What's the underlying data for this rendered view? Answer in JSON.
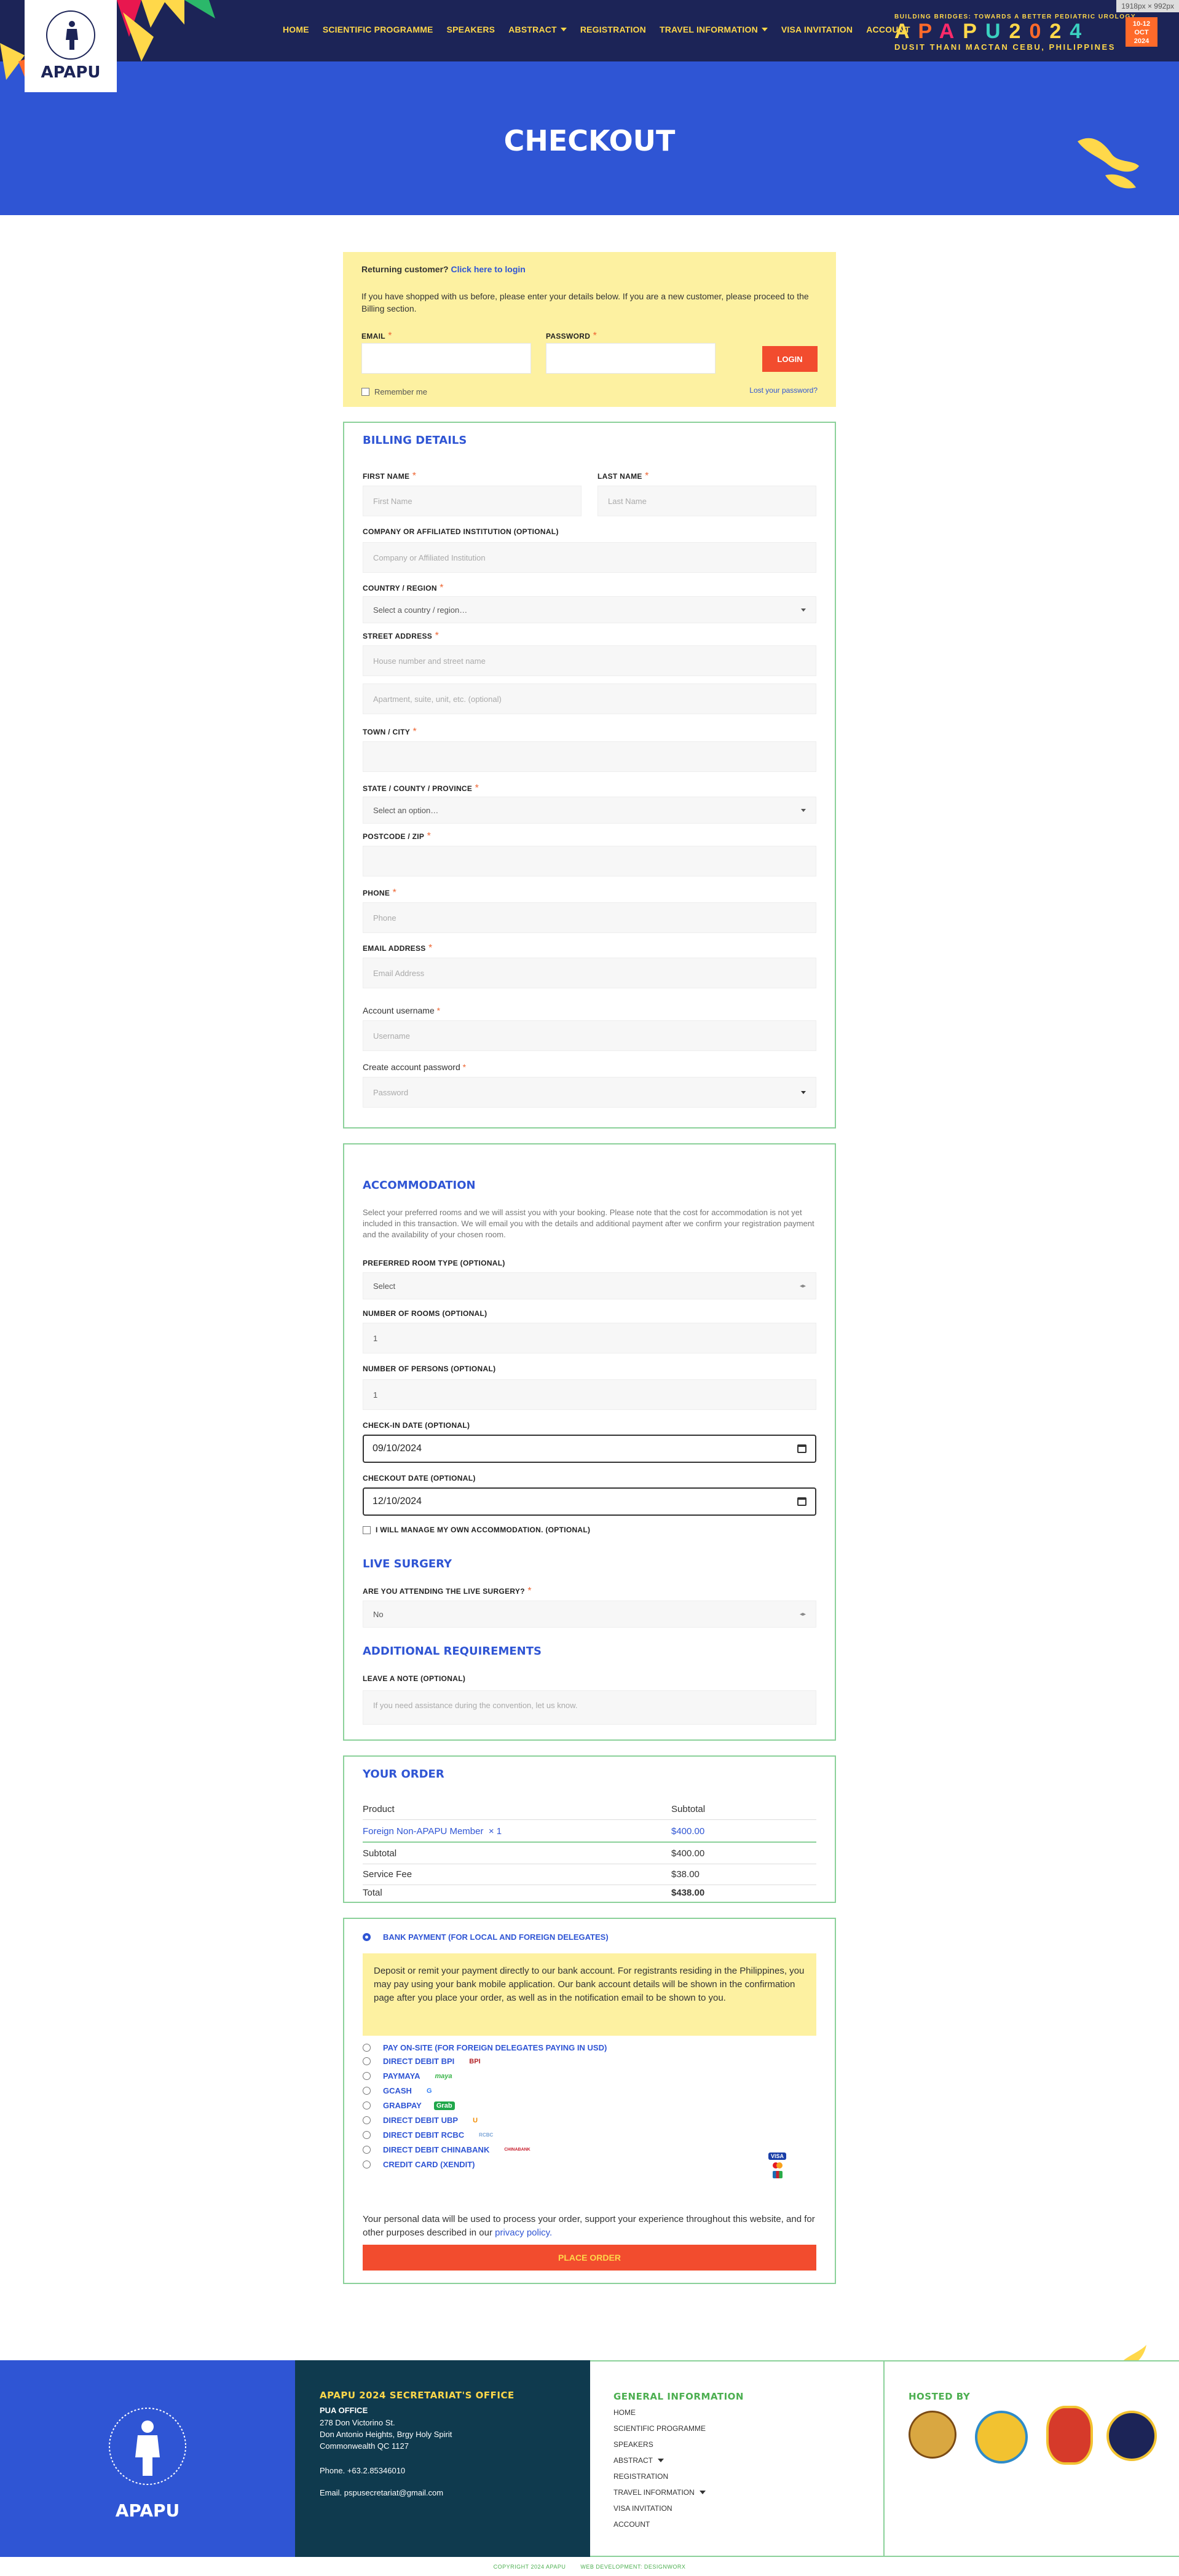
{
  "viewport_badge": "1918px × 992px",
  "header": {
    "logo_text": "APAPU",
    "nav": [
      {
        "label": "HOME"
      },
      {
        "label": "SCIENTIFIC PROGRAMME"
      },
      {
        "label": "SPEAKERS"
      },
      {
        "label": "ABSTRACT",
        "dropdown": true
      },
      {
        "label": "REGISTRATION"
      },
      {
        "label": "TRAVEL INFORMATION",
        "dropdown": true
      },
      {
        "label": "VISA INVITATION"
      },
      {
        "label": "ACCOUNT"
      }
    ],
    "brand_tagline": "BUILDING BRIDGES: TOWARDS A BETTER PEDIATRIC UROLOGY",
    "brand_name": [
      "A",
      "P",
      "A",
      "P",
      "U",
      "2",
      "0",
      "2",
      "4"
    ],
    "brand_location": "DUSIT THANI MACTAN CEBU, PHILIPPINES",
    "date_badge": [
      "10-12",
      "OCT",
      "2024"
    ]
  },
  "hero": {
    "title": "CHECKOUT"
  },
  "login": {
    "returning": "Returning customer?",
    "click_login": "Click here to login",
    "intro": "If you have shopped with us before, please enter your details below. If you are a new customer, please proceed to the Billing section.",
    "email_label": "EMAIL",
    "password_label": "PASSWORD",
    "login_button": "LOGIN",
    "remember": "Remember me",
    "lost_password": "Lost your password?"
  },
  "billing": {
    "title": "BILLING DETAILS",
    "first_name_label": "FIRST NAME",
    "first_name_ph": "First Name",
    "last_name_label": "LAST NAME",
    "last_name_ph": "Last Name",
    "company_label": "COMPANY OR AFFILIATED INSTITUTION (OPTIONAL)",
    "company_ph": "Company or Affiliated Institution",
    "country_label": "COUNTRY / REGION",
    "country_ph": "Select a country / region…",
    "street_label": "STREET ADDRESS",
    "street_ph": "House number and street name",
    "street2_ph": "Apartment, suite, unit, etc. (optional)",
    "town_label": "TOWN / CITY",
    "state_label": "STATE / COUNTY / PROVINCE",
    "state_ph": "Select an option…",
    "postcode_label": "POSTCODE / ZIP",
    "phone_label": "PHONE",
    "phone_ph": "Phone",
    "email_label": "EMAIL ADDRESS",
    "email_ph": "Email Address",
    "username_label": "Account username",
    "username_ph": "Username",
    "acct_password_label": "Create account password",
    "acct_password_ph": "Password"
  },
  "accommodation": {
    "title": "ACCOMMODATION",
    "intro": "Select your preferred rooms and we will assist you with your booking. Please note that the cost for accommodation is not yet included in this transaction. We will email you with the details and additional payment after we confirm your registration payment and the availability of your chosen room.",
    "room_type_label": "PREFERRED ROOM TYPE (OPTIONAL)",
    "room_type_val": "Select",
    "rooms_label": "NUMBER OF ROOMS (OPTIONAL)",
    "rooms_val": "1",
    "persons_label": "NUMBER OF PERSONS (OPTIONAL)",
    "persons_val": "1",
    "checkin_label": "CHECK-IN DATE (OPTIONAL)",
    "checkin_val": "09/10/2024",
    "checkout_label": "CHECKOUT DATE (OPTIONAL)",
    "checkout_val": "12/10/2024",
    "own_accommodation": "I WILL MANAGE MY OWN ACCOMMODATION. (OPTIONAL)",
    "live_title": "LIVE SURGERY",
    "live_label": "ARE YOU ATTENDING THE LIVE SURGERY?",
    "live_val": "No",
    "req_title": "ADDITIONAL REQUIREMENTS",
    "note_label": "LEAVE A NOTE (OPTIONAL)",
    "note_ph": "If you need assistance during the convention, let us know."
  },
  "order": {
    "title": "YOUR ORDER",
    "col_product": "Product",
    "col_subtotal": "Subtotal",
    "item": "Foreign Non-APAPU Member",
    "item_qty": "× 1",
    "item_price": "$400.00",
    "subtotal_label": "Subtotal",
    "subtotal": "$400.00",
    "fee_label": "Service Fee",
    "fee": "$38.00",
    "total_label": "Total",
    "total": "$438.00"
  },
  "payment": {
    "selected": "BANK PAYMENT (FOR LOCAL AND FOREIGN DELEGATES)",
    "notice": "Deposit or remit your payment directly to our bank account. For registrants residing in the Philippines, you may pay using your bank mobile application. Our bank account details will be shown in the confirmation page after you place your order, as well as in the notification email to be shown to you.",
    "options": [
      {
        "label": "PAY ON-SITE (FOR FOREIGN DELEGATES PAYING IN USD)",
        "logo": ""
      },
      {
        "label": "DIRECT DEBIT BPI",
        "logo": "BPI"
      },
      {
        "label": "PAYMAYA",
        "logo": "maya"
      },
      {
        "label": "GCASH",
        "logo": "G"
      },
      {
        "label": "GRABPAY",
        "logo": "Grab"
      },
      {
        "label": "DIRECT DEBIT UBP",
        "logo": "U"
      },
      {
        "label": "DIRECT DEBIT RCBC",
        "logo": "RCBC"
      },
      {
        "label": "DIRECT DEBIT CHINABANK",
        "logo": "CHINABANK"
      },
      {
        "label": "CREDIT CARD (XENDIT)",
        "logo": "VISA"
      }
    ],
    "privacy_text": "Your personal data will be used to process your order, support your experience throughout this website, and for other purposes described in our",
    "privacy_link": "privacy policy.",
    "place_order": "PLACE ORDER"
  },
  "footer": {
    "logo_text": "APAPU",
    "office_title": "APAPU 2024 SECRETARIAT'S OFFICE",
    "office_name": "PUA OFFICE",
    "address1": "278 Don Victorino St.",
    "address2": "Don Antonio Heights, Brgy Holy Spirit",
    "address3": "Commonwealth QC 1127",
    "phone": "Phone. +63.2.85346010",
    "email": "Email. pspusecretariat@gmail.com",
    "general_title": "GENERAL INFORMATION",
    "links": [
      {
        "label": "HOME"
      },
      {
        "label": "SCIENTIFIC PROGRAMME"
      },
      {
        "label": "SPEAKERS"
      },
      {
        "label": "ABSTRACT",
        "dropdown": true
      },
      {
        "label": "REGISTRATION"
      },
      {
        "label": "TRAVEL INFORMATION",
        "dropdown": true
      },
      {
        "label": "VISA INVITATION"
      },
      {
        "label": "ACCOUNT"
      }
    ],
    "hosted_title": "HOSTED BY",
    "copyright": "COPYRIGHT 2024 APAPU",
    "webdev": "WEB DEVELOPMENT: DESIGNWORX"
  },
  "colors": {
    "navy": "#1c2457",
    "blue": "#2f55d4",
    "yellow": "#ffd84a",
    "orange": "#f24c2e",
    "green": "#8bd19a"
  }
}
